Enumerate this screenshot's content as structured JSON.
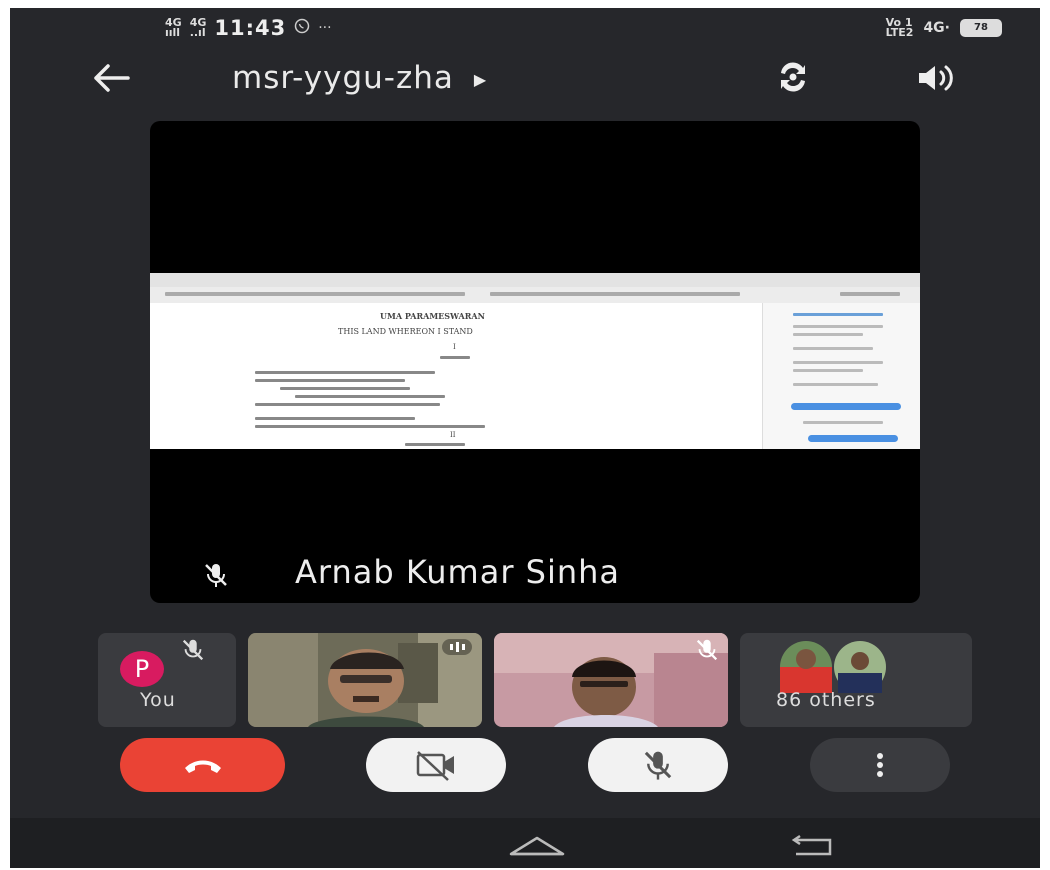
{
  "status_bar": {
    "sig1_top": "4G",
    "sig1_bottom": "ııll",
    "sig2_top": "4G",
    "sig2_bottom": "..ıl",
    "time": "11:43",
    "ellipsis": "···",
    "volte_top": "Vo 1",
    "volte_bottom": "LTE2",
    "net": "4G·",
    "battery": "78"
  },
  "header": {
    "meeting_code": "msr-yygu-zha",
    "back_icon": "arrow-left-icon",
    "switch_camera_icon": "switch-camera-icon",
    "speaker_icon": "speaker-icon"
  },
  "presentation": {
    "presenter_name": "Arnab Kumar Sinha",
    "doc_author": "UMA PARAMESWARAN",
    "doc_title": "THIS LAND WHEREON I STAND",
    "doc_section_1": "I",
    "doc_section_2": "II"
  },
  "participants": {
    "you_initial": "P",
    "you_label": "You",
    "others_label": "86 others"
  },
  "controls": {
    "end_call_icon": "hang-up-icon",
    "camera_icon": "camera-off-icon",
    "mic_icon": "mic-off-icon",
    "more_icon": "more-vert-icon"
  },
  "colors": {
    "background": "#26272b",
    "end_call": "#ea4335",
    "avatar": "#d81b60"
  }
}
